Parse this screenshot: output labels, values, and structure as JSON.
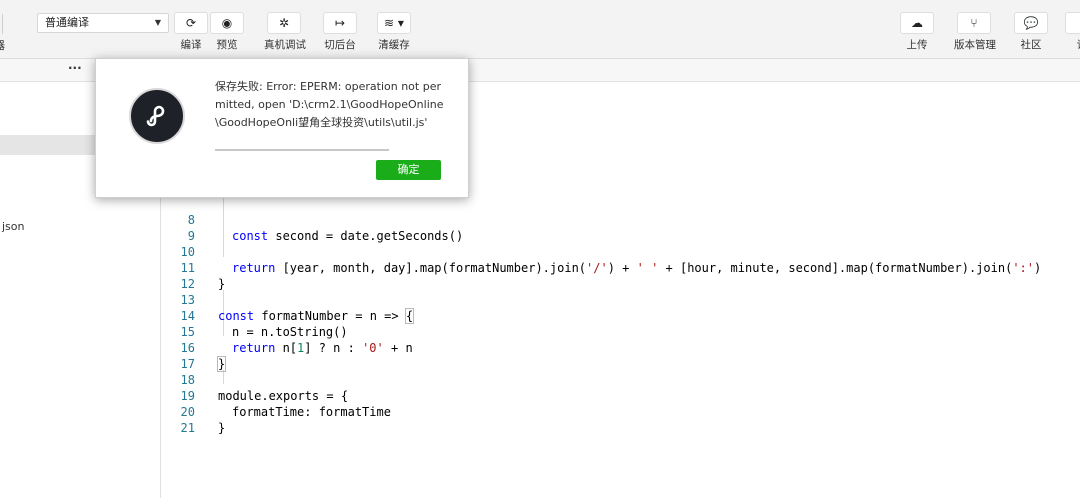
{
  "toolbar": {
    "left_cut_label": "器",
    "compile_mode": "普通编译",
    "buttons_left": [
      {
        "label": "编译",
        "icon": "refresh-icon",
        "glyph": "⟳"
      },
      {
        "label": "预览",
        "icon": "eye-icon",
        "glyph": "◉"
      },
      {
        "label": "真机调试",
        "icon": "bug-icon",
        "glyph": "✲"
      },
      {
        "label": "切后台",
        "icon": "switch-background-icon",
        "glyph": "↦"
      },
      {
        "label": "清缓存",
        "icon": "layers-icon",
        "glyph": "≋ ▾"
      }
    ],
    "buttons_right": [
      {
        "label": "上传",
        "icon": "cloud-upload-icon",
        "glyph": "☁"
      },
      {
        "label": "版本管理",
        "icon": "branch-icon",
        "glyph": "⑂"
      },
      {
        "label": "社区",
        "icon": "chat-icon",
        "glyph": "💬"
      },
      {
        "label": "详",
        "icon": "details-icon",
        "glyph": ""
      }
    ]
  },
  "sidebar": {
    "more": "···",
    "json_label": "json"
  },
  "editor": {
    "lines": [
      {
        "n": "8",
        "code": "const second = date.getSeconds()"
      },
      {
        "n": "9",
        "code": ""
      },
      {
        "n": "10",
        "code": "return [year, month, day].map(formatNumber).join('/') + ' ' + [hour, minute, second].map(formatNumber).join(':')"
      },
      {
        "n": "11",
        "code": "}"
      },
      {
        "n": "12",
        "code": ""
      },
      {
        "n": "13",
        "code": "const formatNumber = n => {"
      },
      {
        "n": "14",
        "code": "n = n.toString()"
      },
      {
        "n": "15",
        "code": "return n[1] ? n : '0' + n"
      },
      {
        "n": "16",
        "code": "}"
      },
      {
        "n": "17",
        "code": ""
      },
      {
        "n": "18",
        "code": "module.exports = {"
      },
      {
        "n": "19",
        "code": "formatTime: formatTime"
      },
      {
        "n": "20",
        "code": "}"
      },
      {
        "n": "21",
        "code": ""
      }
    ]
  },
  "dialog": {
    "message": "保存失败:  Error: EPERM: operation not permitted, open 'D:\\crm2.1\\GoodHopeOnline\\GoodHopeOnli望角全球投资\\utils\\util.js'",
    "ok_label": "确定",
    "ok_color": "#1aad19"
  }
}
